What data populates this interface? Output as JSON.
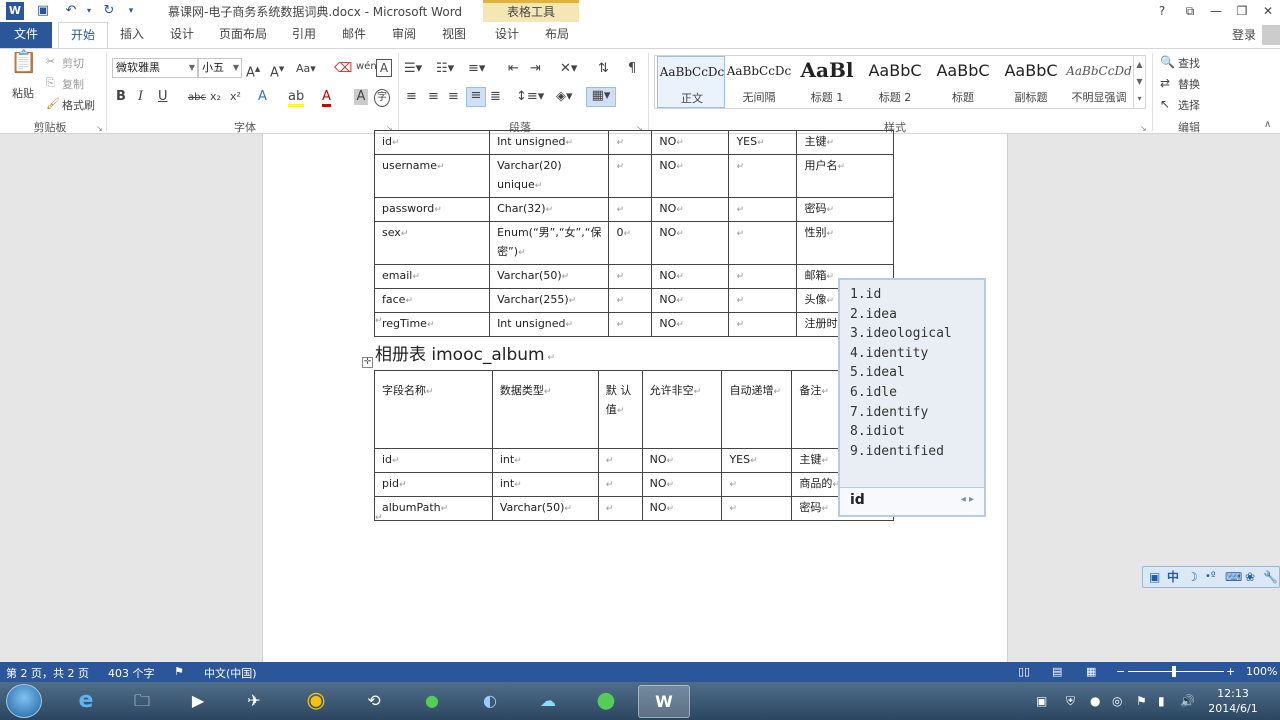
{
  "window": {
    "title": "慕课网-电子商务系统数据词典.docx - Microsoft Word",
    "tools_group": "表格工具",
    "help": "?",
    "login": "登录"
  },
  "tabs": [
    "文件",
    "开始",
    "插入",
    "设计",
    "页面布局",
    "引用",
    "邮件",
    "审阅",
    "视图",
    "设计",
    "布局"
  ],
  "ribbon": {
    "clipboard": {
      "label": "剪贴板",
      "paste": "粘贴",
      "cut": "剪切",
      "copy": "复制",
      "format_painter": "格式刷"
    },
    "font": {
      "label": "字体",
      "name": "微软雅黑",
      "size": "小五"
    },
    "paragraph": {
      "label": "段落"
    },
    "styles": {
      "label": "样式",
      "items": [
        {
          "sample": "AaBbCcDc",
          "name": "正文"
        },
        {
          "sample": "AaBbCcDc",
          "name": "无间隔"
        },
        {
          "sample": "AaBl",
          "name": "标题 1"
        },
        {
          "sample": "AaBbC",
          "name": "标题 2"
        },
        {
          "sample": "AaBbC",
          "name": "标题"
        },
        {
          "sample": "AaBbC",
          "name": "副标题"
        },
        {
          "sample": "AaBbCcDd",
          "name": "不明显强调"
        }
      ]
    },
    "editing": {
      "label": "编辑",
      "find": "查找",
      "replace": "替换",
      "select": "选择"
    }
  },
  "document": {
    "table1_rows": [
      [
        "id",
        "Int   unsigned",
        "",
        "NO",
        "YES",
        "主键"
      ],
      [
        "username",
        "Varchar(20) unique",
        "",
        "NO",
        "",
        "用户名"
      ],
      [
        "password",
        "Char(32)",
        "",
        "NO",
        "",
        "密码"
      ],
      [
        "sex",
        "Enum(“男”,“女”,“保密”)",
        "0",
        "NO",
        "",
        "性别"
      ],
      [
        "email",
        "Varchar(50)",
        "",
        "NO",
        "",
        "邮箱"
      ],
      [
        "face",
        "Varchar(255)",
        "",
        "NO",
        "",
        "头像"
      ],
      [
        "regTime",
        "Int unsigned",
        "",
        "NO",
        "",
        "注册时"
      ]
    ],
    "heading": "相册表 imooc_album",
    "table2_header": [
      "字段名称",
      "数据类型",
      "默 认 值",
      "允许非空",
      "自动递增",
      "备注"
    ],
    "table2_rows": [
      [
        "id",
        "int",
        "",
        "NO",
        "YES",
        "主键"
      ],
      [
        "pid",
        "int",
        "",
        "NO",
        "",
        "商品的"
      ],
      [
        "albumPath",
        "Varchar(50)",
        "",
        "NO",
        "",
        "密码"
      ]
    ]
  },
  "ime": {
    "candidates": [
      "1.id",
      "2.idea",
      "3.ideological",
      "4.identity",
      "5.ideal",
      "6.idle",
      "7.identify",
      "8.idiot",
      "9.identified"
    ],
    "input": "id",
    "toolbar_mode": "中"
  },
  "statusbar": {
    "page": "第 2 页，共 2 页",
    "words": "403 个字",
    "language": "中文(中国)",
    "zoom": "100%"
  },
  "taskbar": {
    "time": "12:13",
    "date": "2014/6/1"
  }
}
